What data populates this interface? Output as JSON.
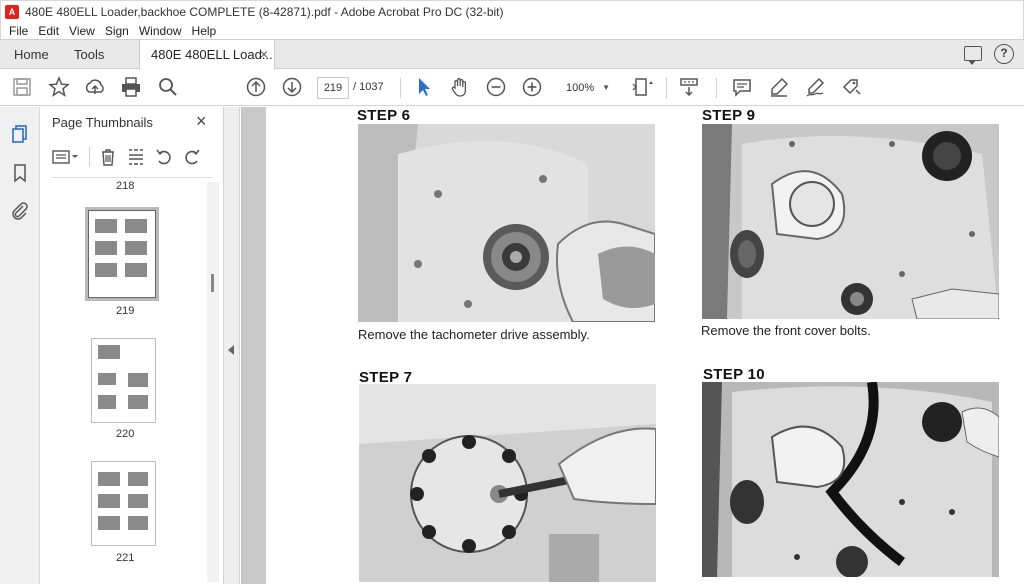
{
  "window": {
    "title": "480E 480ELL Loader,backhoe COMPLETE (8-42871).pdf - Adobe Acrobat Pro DC (32-bit)"
  },
  "menu": [
    "File",
    "Edit",
    "View",
    "Sign",
    "Window",
    "Help"
  ],
  "tabs": {
    "home": "Home",
    "tools": "Tools",
    "document": "480E 480ELL Load...",
    "close": "×"
  },
  "toolbar": {
    "current_page": "219",
    "total_pages": "/ 1037",
    "zoom": "100%"
  },
  "thumbnail_panel": {
    "title": "Page Thumbnails",
    "close": "×",
    "pages": [
      {
        "label": "218"
      },
      {
        "label": "219",
        "current": true
      },
      {
        "label": "220"
      },
      {
        "label": "221"
      }
    ]
  },
  "document": {
    "steps": [
      {
        "heading": "STEP 6",
        "caption": "Remove the tachometer drive assembly."
      },
      {
        "heading": "STEP 9",
        "caption": "Remove the front cover bolts."
      },
      {
        "heading": "STEP 7",
        "caption": ""
      },
      {
        "heading": "STEP 10",
        "caption": ""
      }
    ]
  },
  "icons": {
    "app": "acrobat-icon",
    "toolbar": [
      "save-icon",
      "star-icon",
      "upload-icon",
      "print-icon",
      "search-icon",
      "page-up-icon",
      "page-down-icon",
      "select-cursor-icon",
      "hand-icon",
      "zoom-out-icon",
      "zoom-in-icon",
      "fit-page-icon",
      "scroll-mode-icon",
      "comment-icon",
      "highlight-icon",
      "sign-icon",
      "fill-sign-icon"
    ]
  }
}
